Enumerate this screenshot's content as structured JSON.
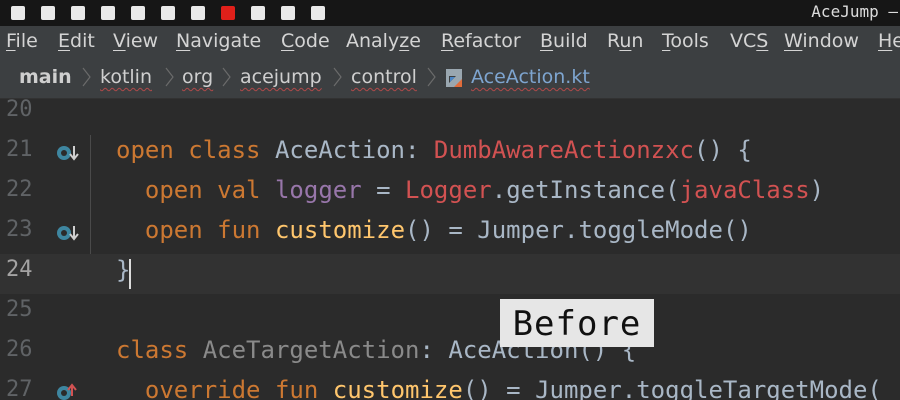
{
  "window": {
    "title": "AceJump —"
  },
  "menu": [
    {
      "pre": "",
      "mn": "F",
      "post": "ile"
    },
    {
      "pre": "",
      "mn": "E",
      "post": "dit"
    },
    {
      "pre": "",
      "mn": "V",
      "post": "iew"
    },
    {
      "pre": "",
      "mn": "N",
      "post": "avigate"
    },
    {
      "pre": "",
      "mn": "C",
      "post": "ode"
    },
    {
      "pre": "Analy",
      "mn": "z",
      "post": "e"
    },
    {
      "pre": "",
      "mn": "R",
      "post": "efactor"
    },
    {
      "pre": "",
      "mn": "B",
      "post": "uild"
    },
    {
      "pre": "R",
      "mn": "u",
      "post": "n"
    },
    {
      "pre": "",
      "mn": "T",
      "post": "ools"
    },
    {
      "pre": "VC",
      "mn": "S",
      "post": ""
    },
    {
      "pre": "",
      "mn": "W",
      "post": "indow"
    },
    {
      "pre": "",
      "mn": "H",
      "post": "e"
    }
  ],
  "breadcrumb": [
    "main",
    "kotlin",
    "org",
    "acejump",
    "control",
    "AceAction.kt"
  ],
  "editor": {
    "lines": [
      {
        "no": "20",
        "text": ""
      },
      {
        "no": "21",
        "text": "open class AceAction: DumbAwareActionzxc() {",
        "icon": "override-down"
      },
      {
        "no": "22",
        "text": "  open val logger = Logger.getInstance(javaClass)"
      },
      {
        "no": "23",
        "text": "  open fun customize() = Jumper.toggleMode()",
        "icon": "override-down"
      },
      {
        "no": "24",
        "text": "}",
        "current": true
      },
      {
        "no": "25",
        "text": ""
      },
      {
        "no": "26",
        "text": "class AceTargetAction: AceAction() {"
      },
      {
        "no": "27",
        "text": "  override fun customize() = Jumper.toggleTargetMode(",
        "icon": "override-up"
      }
    ]
  },
  "overlay": {
    "caption": "Before"
  },
  "colors": {
    "keyword": "#cc7832",
    "error": "#d25252",
    "function": "#ffc66d",
    "property": "#9876aa",
    "text": "#a9b7c6"
  }
}
